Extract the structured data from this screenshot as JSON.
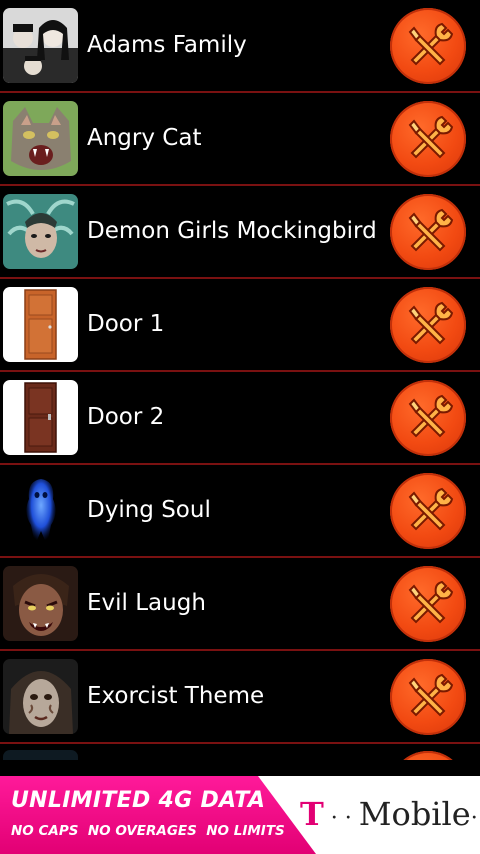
{
  "list": {
    "items": [
      {
        "label": "Adams Family",
        "thumb_icon": "adams-family-thumbnail",
        "button_icon": "tools-icon"
      },
      {
        "label": "Angry Cat",
        "thumb_icon": "angry-cat-thumbnail",
        "button_icon": "tools-icon"
      },
      {
        "label": "Demon Girls Mockingbird",
        "thumb_icon": "demon-girl-thumbnail",
        "button_icon": "tools-icon"
      },
      {
        "label": "Door 1",
        "thumb_icon": "door-thumbnail",
        "button_icon": "tools-icon"
      },
      {
        "label": "Door 2",
        "thumb_icon": "door-thumbnail",
        "button_icon": "tools-icon"
      },
      {
        "label": "Dying Soul",
        "thumb_icon": "ghost-thumbnail",
        "button_icon": "tools-icon"
      },
      {
        "label": "Evil Laugh",
        "thumb_icon": "evil-face-thumbnail",
        "button_icon": "tools-icon"
      },
      {
        "label": "Exorcist Theme",
        "thumb_icon": "exorcist-face-thumbnail",
        "button_icon": "tools-icon"
      }
    ]
  },
  "ad": {
    "headline": "UNLIMITED 4G DATA",
    "subline": "NO CAPS  NO OVERAGES  NO LIMITS",
    "brand_t": "T",
    "brand_dots": " · · ",
    "brand_name": "Mobile",
    "brand_tail": "·"
  },
  "colors": {
    "background": "#000000",
    "divider": "#7a1111",
    "tool_button": "#f24a12",
    "ad_pink": "#e20074"
  }
}
